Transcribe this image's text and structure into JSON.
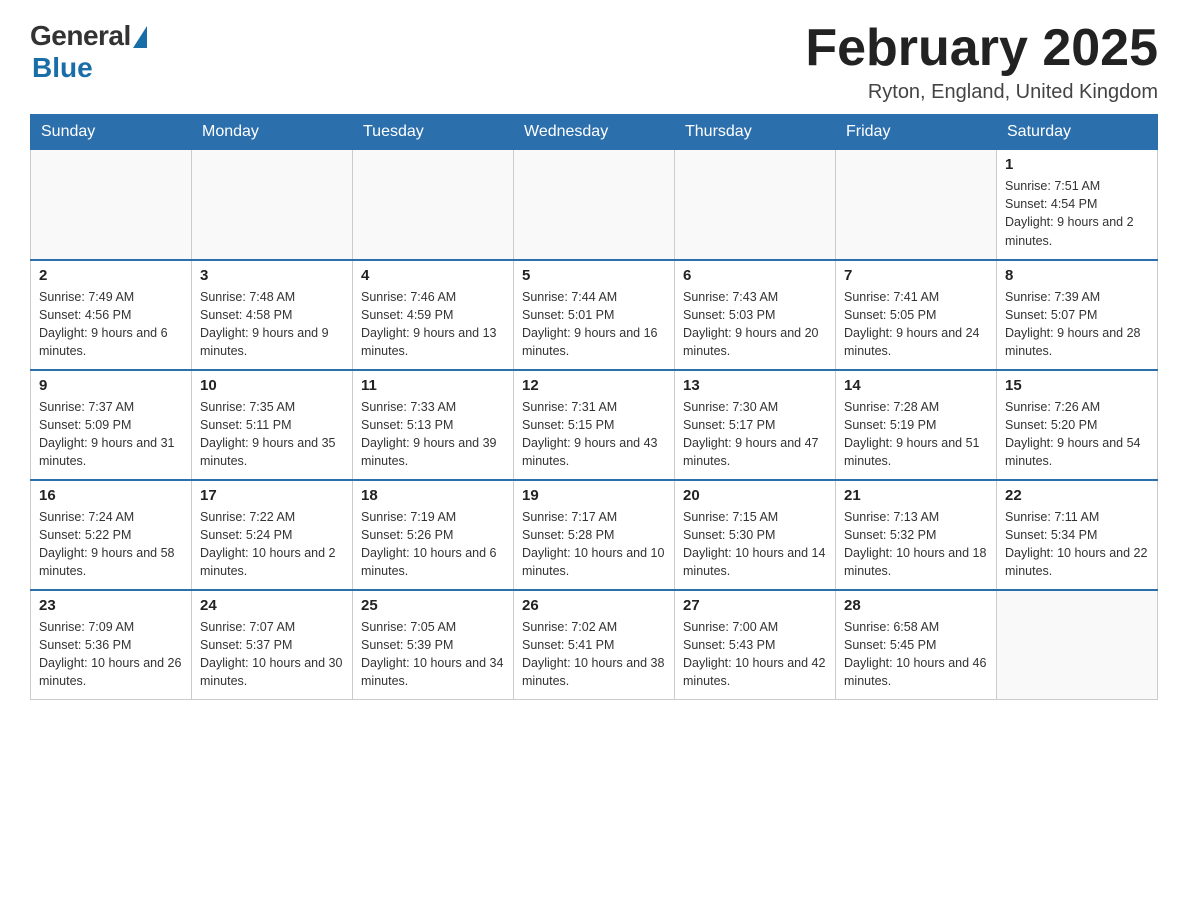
{
  "header": {
    "logo_general": "General",
    "logo_blue": "Blue",
    "month_title": "February 2025",
    "location": "Ryton, England, United Kingdom"
  },
  "days_of_week": [
    "Sunday",
    "Monday",
    "Tuesday",
    "Wednesday",
    "Thursday",
    "Friday",
    "Saturday"
  ],
  "weeks": [
    [
      {
        "day": "",
        "info": ""
      },
      {
        "day": "",
        "info": ""
      },
      {
        "day": "",
        "info": ""
      },
      {
        "day": "",
        "info": ""
      },
      {
        "day": "",
        "info": ""
      },
      {
        "day": "",
        "info": ""
      },
      {
        "day": "1",
        "info": "Sunrise: 7:51 AM\nSunset: 4:54 PM\nDaylight: 9 hours and 2 minutes."
      }
    ],
    [
      {
        "day": "2",
        "info": "Sunrise: 7:49 AM\nSunset: 4:56 PM\nDaylight: 9 hours and 6 minutes."
      },
      {
        "day": "3",
        "info": "Sunrise: 7:48 AM\nSunset: 4:58 PM\nDaylight: 9 hours and 9 minutes."
      },
      {
        "day": "4",
        "info": "Sunrise: 7:46 AM\nSunset: 4:59 PM\nDaylight: 9 hours and 13 minutes."
      },
      {
        "day": "5",
        "info": "Sunrise: 7:44 AM\nSunset: 5:01 PM\nDaylight: 9 hours and 16 minutes."
      },
      {
        "day": "6",
        "info": "Sunrise: 7:43 AM\nSunset: 5:03 PM\nDaylight: 9 hours and 20 minutes."
      },
      {
        "day": "7",
        "info": "Sunrise: 7:41 AM\nSunset: 5:05 PM\nDaylight: 9 hours and 24 minutes."
      },
      {
        "day": "8",
        "info": "Sunrise: 7:39 AM\nSunset: 5:07 PM\nDaylight: 9 hours and 28 minutes."
      }
    ],
    [
      {
        "day": "9",
        "info": "Sunrise: 7:37 AM\nSunset: 5:09 PM\nDaylight: 9 hours and 31 minutes."
      },
      {
        "day": "10",
        "info": "Sunrise: 7:35 AM\nSunset: 5:11 PM\nDaylight: 9 hours and 35 minutes."
      },
      {
        "day": "11",
        "info": "Sunrise: 7:33 AM\nSunset: 5:13 PM\nDaylight: 9 hours and 39 minutes."
      },
      {
        "day": "12",
        "info": "Sunrise: 7:31 AM\nSunset: 5:15 PM\nDaylight: 9 hours and 43 minutes."
      },
      {
        "day": "13",
        "info": "Sunrise: 7:30 AM\nSunset: 5:17 PM\nDaylight: 9 hours and 47 minutes."
      },
      {
        "day": "14",
        "info": "Sunrise: 7:28 AM\nSunset: 5:19 PM\nDaylight: 9 hours and 51 minutes."
      },
      {
        "day": "15",
        "info": "Sunrise: 7:26 AM\nSunset: 5:20 PM\nDaylight: 9 hours and 54 minutes."
      }
    ],
    [
      {
        "day": "16",
        "info": "Sunrise: 7:24 AM\nSunset: 5:22 PM\nDaylight: 9 hours and 58 minutes."
      },
      {
        "day": "17",
        "info": "Sunrise: 7:22 AM\nSunset: 5:24 PM\nDaylight: 10 hours and 2 minutes."
      },
      {
        "day": "18",
        "info": "Sunrise: 7:19 AM\nSunset: 5:26 PM\nDaylight: 10 hours and 6 minutes."
      },
      {
        "day": "19",
        "info": "Sunrise: 7:17 AM\nSunset: 5:28 PM\nDaylight: 10 hours and 10 minutes."
      },
      {
        "day": "20",
        "info": "Sunrise: 7:15 AM\nSunset: 5:30 PM\nDaylight: 10 hours and 14 minutes."
      },
      {
        "day": "21",
        "info": "Sunrise: 7:13 AM\nSunset: 5:32 PM\nDaylight: 10 hours and 18 minutes."
      },
      {
        "day": "22",
        "info": "Sunrise: 7:11 AM\nSunset: 5:34 PM\nDaylight: 10 hours and 22 minutes."
      }
    ],
    [
      {
        "day": "23",
        "info": "Sunrise: 7:09 AM\nSunset: 5:36 PM\nDaylight: 10 hours and 26 minutes."
      },
      {
        "day": "24",
        "info": "Sunrise: 7:07 AM\nSunset: 5:37 PM\nDaylight: 10 hours and 30 minutes."
      },
      {
        "day": "25",
        "info": "Sunrise: 7:05 AM\nSunset: 5:39 PM\nDaylight: 10 hours and 34 minutes."
      },
      {
        "day": "26",
        "info": "Sunrise: 7:02 AM\nSunset: 5:41 PM\nDaylight: 10 hours and 38 minutes."
      },
      {
        "day": "27",
        "info": "Sunrise: 7:00 AM\nSunset: 5:43 PM\nDaylight: 10 hours and 42 minutes."
      },
      {
        "day": "28",
        "info": "Sunrise: 6:58 AM\nSunset: 5:45 PM\nDaylight: 10 hours and 46 minutes."
      },
      {
        "day": "",
        "info": ""
      }
    ]
  ]
}
